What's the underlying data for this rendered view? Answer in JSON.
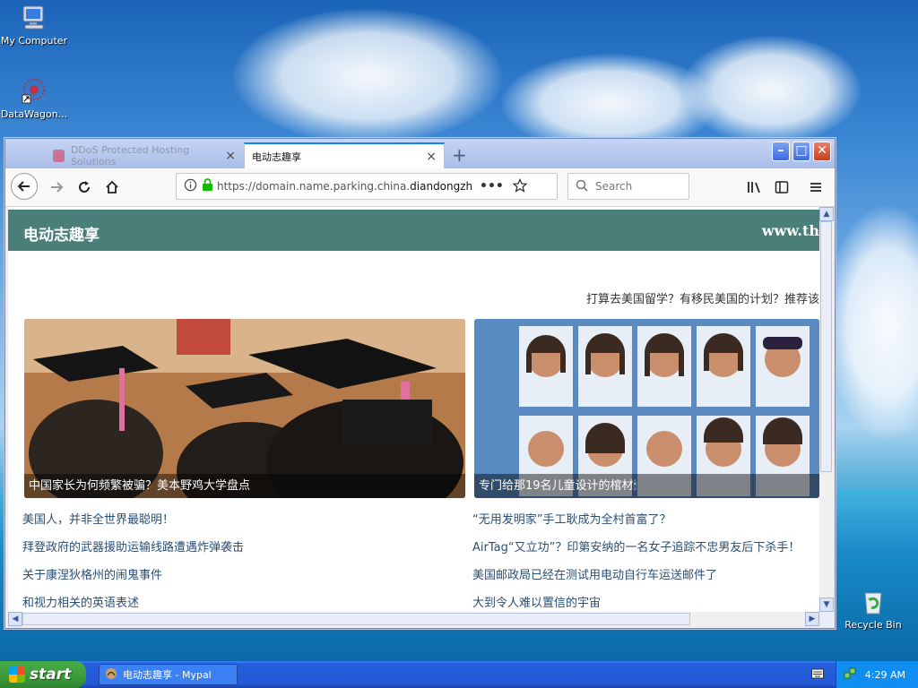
{
  "desktop": {
    "icons": [
      {
        "label": "My Computer"
      },
      {
        "label": "DataWagon..."
      },
      {
        "label": "Recycle Bin"
      }
    ]
  },
  "browser": {
    "tabs": [
      {
        "label": "DDoS Protected Hosting Solutions",
        "active": false
      },
      {
        "label": "电动志趣享",
        "active": true
      }
    ],
    "url": {
      "prefix": "https://domain.name.parking.china.",
      "domain": "diandongzhi.c"
    },
    "search_placeholder": "Search"
  },
  "page": {
    "site_title": "电动志趣享",
    "site_url": "www.th",
    "promo": "打算去美国留学？有移民美国的计划？推荐该",
    "cards": [
      {
        "caption": "中国家长为何频繁被骗？美本野鸡大学盘点"
      },
      {
        "caption": "专门给那19名儿童设计的棺材🕯"
      }
    ],
    "links_left": [
      "美国人，并非全世界最聪明！",
      "拜登政府的武器援助运输线路遭遇炸弹袭击",
      "关于康涅狄格州的闹鬼事件",
      "和视力相关的英语表述"
    ],
    "links_right": [
      "“无用发明家”手工耿成为全村首富了？",
      "AirTag“又立功”？印第安纳的一名女子追踪不忠男友后下杀手！",
      "美国邮政局已经在测试用电动自行车运送邮件了",
      "大到令人难以置信的宇宙"
    ]
  },
  "taskbar": {
    "start_label": "start",
    "task_label": "电动志趣享 - Mypal",
    "clock": "4:29 AM"
  },
  "colors": {
    "site_header": "#4a7e78",
    "link": "#2a4e73",
    "taskbar": "#245edb",
    "start": "#3a9a3a"
  }
}
